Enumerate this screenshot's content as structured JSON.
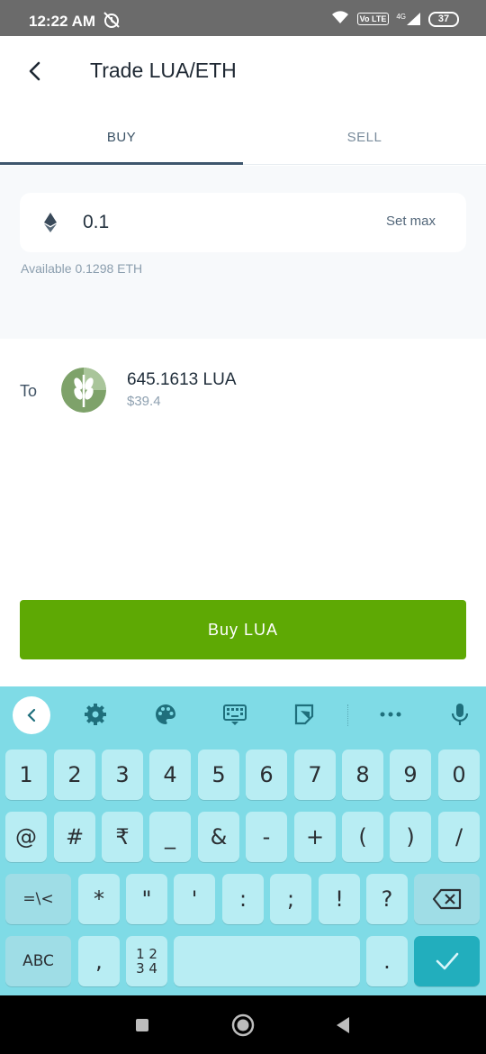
{
  "status_bar": {
    "time": "12:22 AM",
    "network": "4G",
    "volte": "Vo LTE",
    "battery": "37"
  },
  "header": {
    "back_icon": "chevron-left-icon",
    "title": "Trade LUA/ETH"
  },
  "tabs": [
    {
      "label": "BUY",
      "active": true
    },
    {
      "label": "SELL",
      "active": false
    }
  ],
  "amount": {
    "value": "0.1",
    "set_max_label": "Set max",
    "available_text": "Available 0.1298 ETH",
    "icon": "ethereum-icon"
  },
  "to": {
    "label": "To",
    "token_amount": "645.1613 LUA",
    "token_usd": "$39.4",
    "logo_icon": "luaswap-wheat-icon"
  },
  "buy_button_label": "Buy LUA",
  "keyboard": {
    "toolbar": [
      "collapse-icon",
      "settings-icon",
      "palette-icon",
      "keyboard-icon",
      "sticker-icon",
      "more-icon",
      "mic-icon"
    ],
    "row1": [
      "1",
      "2",
      "3",
      "4",
      "5",
      "6",
      "7",
      "8",
      "9",
      "0"
    ],
    "row2": [
      "@",
      "#",
      "₹",
      "_",
      "&",
      "-",
      "+",
      "(",
      ")",
      "/"
    ],
    "row3": [
      "=\\<",
      "*",
      "\"",
      "'",
      ":",
      ";",
      "!",
      "?"
    ],
    "row4": {
      "abc": "ABC",
      "comma": ",",
      "numpad_top": "1 2",
      "numpad_bottom": "3 4",
      "period": "."
    }
  },
  "colors": {
    "accent_green": "#5ea904",
    "keyboard_bg": "#7fdbe6",
    "tab_indicator": "#3e566d"
  }
}
